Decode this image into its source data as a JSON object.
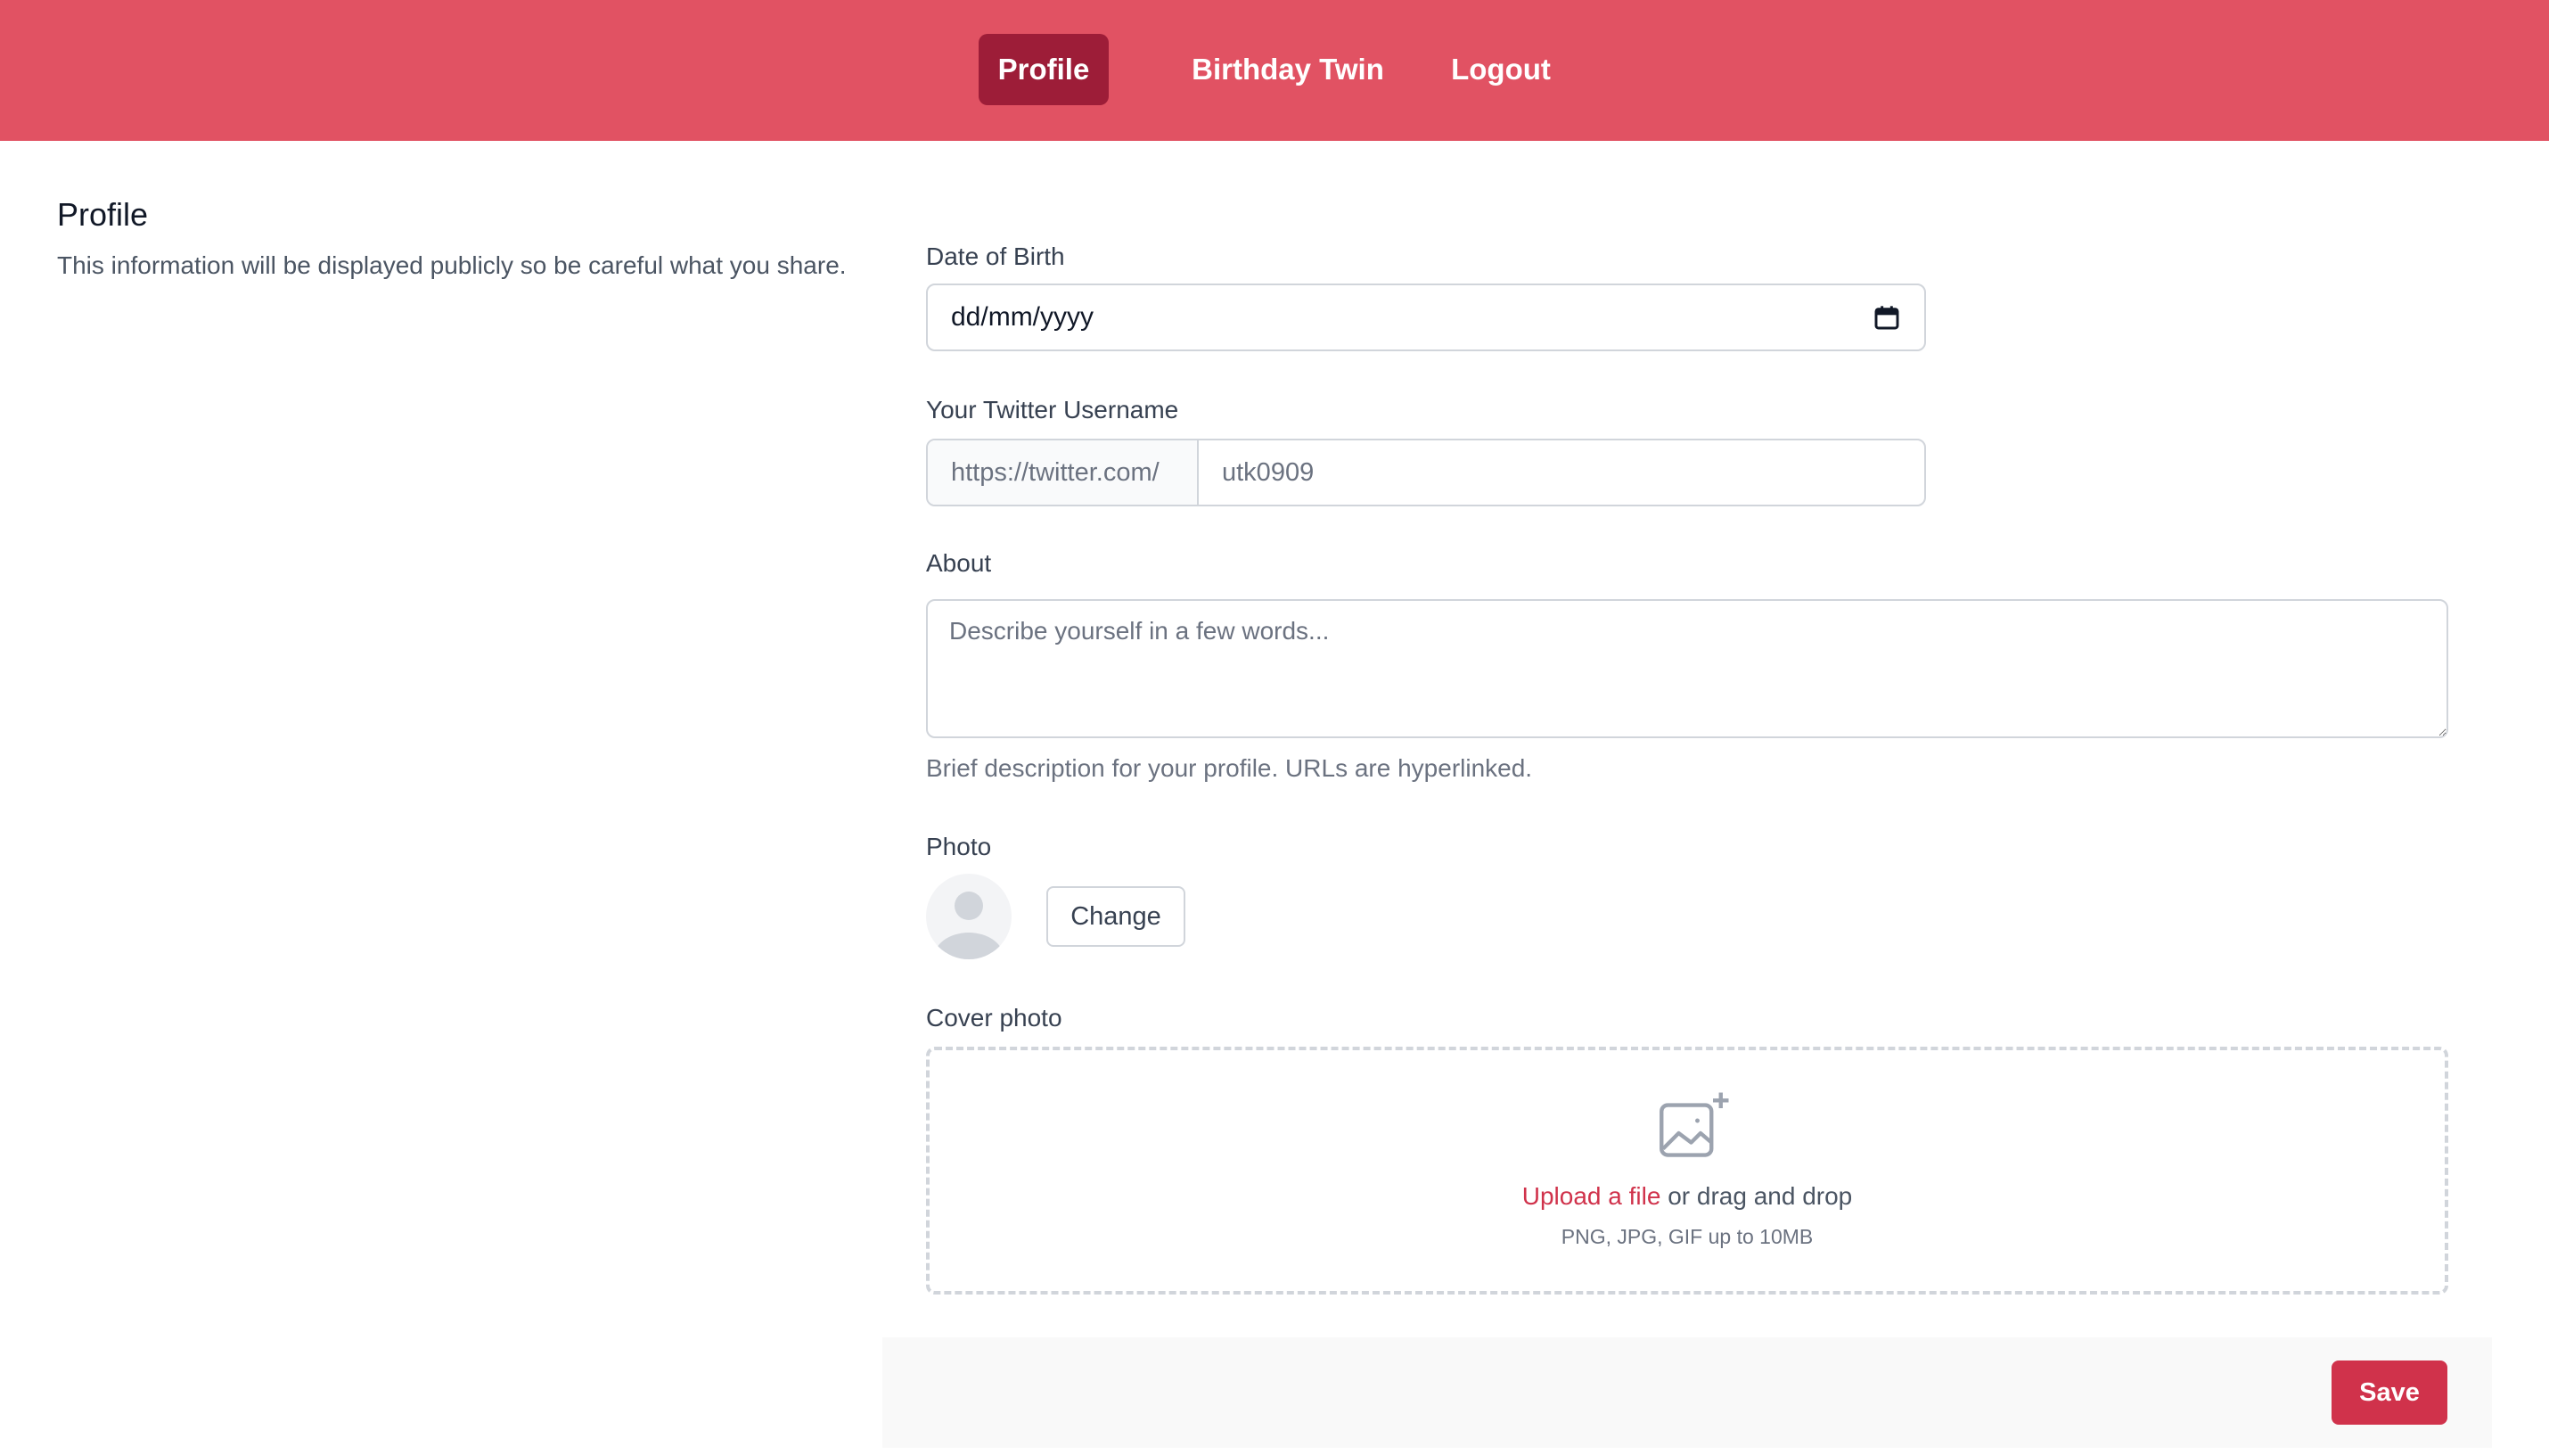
{
  "nav": {
    "items": [
      {
        "label": "Profile",
        "active": true
      },
      {
        "label": "Birthday Twin",
        "active": false
      },
      {
        "label": "Logout",
        "active": false
      }
    ]
  },
  "section": {
    "title": "Profile",
    "description": "This information will be displayed publicly so be careful what you share."
  },
  "form": {
    "dob": {
      "label": "Date of Birth",
      "value": "dd/mm/yyyy",
      "icon": "calendar-icon"
    },
    "twitter": {
      "label": "Your Twitter Username",
      "prefix": "https://twitter.com/",
      "value": "utk0909"
    },
    "about": {
      "label": "About",
      "placeholder": "Describe yourself in a few words...",
      "help": "Brief description for your profile. URLs are hyperlinked."
    },
    "photo": {
      "label": "Photo",
      "change_label": "Change",
      "icon": "avatar-placeholder-icon"
    },
    "cover": {
      "label": "Cover photo",
      "upload_link": "Upload a file",
      "upload_text": " or drag and drop",
      "file_types": "PNG, JPG, GIF up to 10MB",
      "icon": "image-add-icon"
    },
    "save_label": "Save"
  },
  "colors": {
    "navbar": "#e15263",
    "nav_active": "#9d1d38",
    "accent": "#d0324b",
    "footer_bg": "#f9f9f9"
  }
}
